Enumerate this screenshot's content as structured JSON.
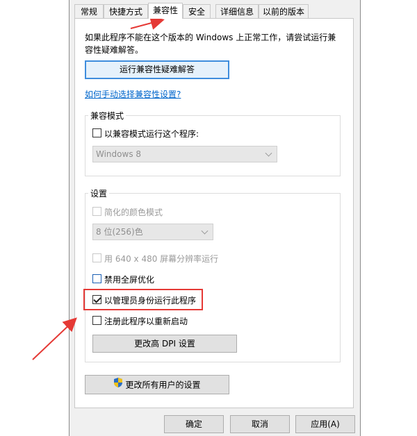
{
  "tabs": [
    {
      "label": "常规"
    },
    {
      "label": "快捷方式"
    },
    {
      "label": "兼容性"
    },
    {
      "label": "安全"
    },
    {
      "label": "详细信息"
    },
    {
      "label": "以前的版本"
    }
  ],
  "intro": {
    "line1": "如果此程序不能在这个版本的 Windows 上正常工作，请尝试运行兼",
    "line2": "容性疑难解答。"
  },
  "troubleshoot_button": "运行兼容性疑难解答",
  "manual_link": "如何手动选择兼容性设置?",
  "compat_mode": {
    "title": "兼容模式",
    "checkbox_label": "以兼容模式运行这个程序:",
    "checked": false,
    "os_select_value": "Windows 8"
  },
  "settings": {
    "title": "设置",
    "reduced_color": {
      "label": "简化的颜色模式",
      "checked": false,
      "enabled": false
    },
    "color_select_value": "8 位(256)色",
    "res_640": {
      "label": "用 640 x 480 屏幕分辨率运行",
      "checked": false,
      "enabled": false
    },
    "disable_fullscreen": {
      "label": "禁用全屏优化",
      "checked": false
    },
    "run_as_admin": {
      "label": "以管理员身份运行此程序",
      "checked": true
    },
    "register_restart": {
      "label": "注册此程序以重新启动",
      "checked": false
    },
    "dpi_button": "更改高 DPI 设置"
  },
  "all_users_button": "更改所有用户的设置",
  "footer": {
    "ok": "确定",
    "cancel": "取消",
    "apply": "应用(A)"
  },
  "colors": {
    "accent_link": "#0066cc",
    "annotation_red": "#e53935",
    "focus_border": "#3e8ddd"
  }
}
